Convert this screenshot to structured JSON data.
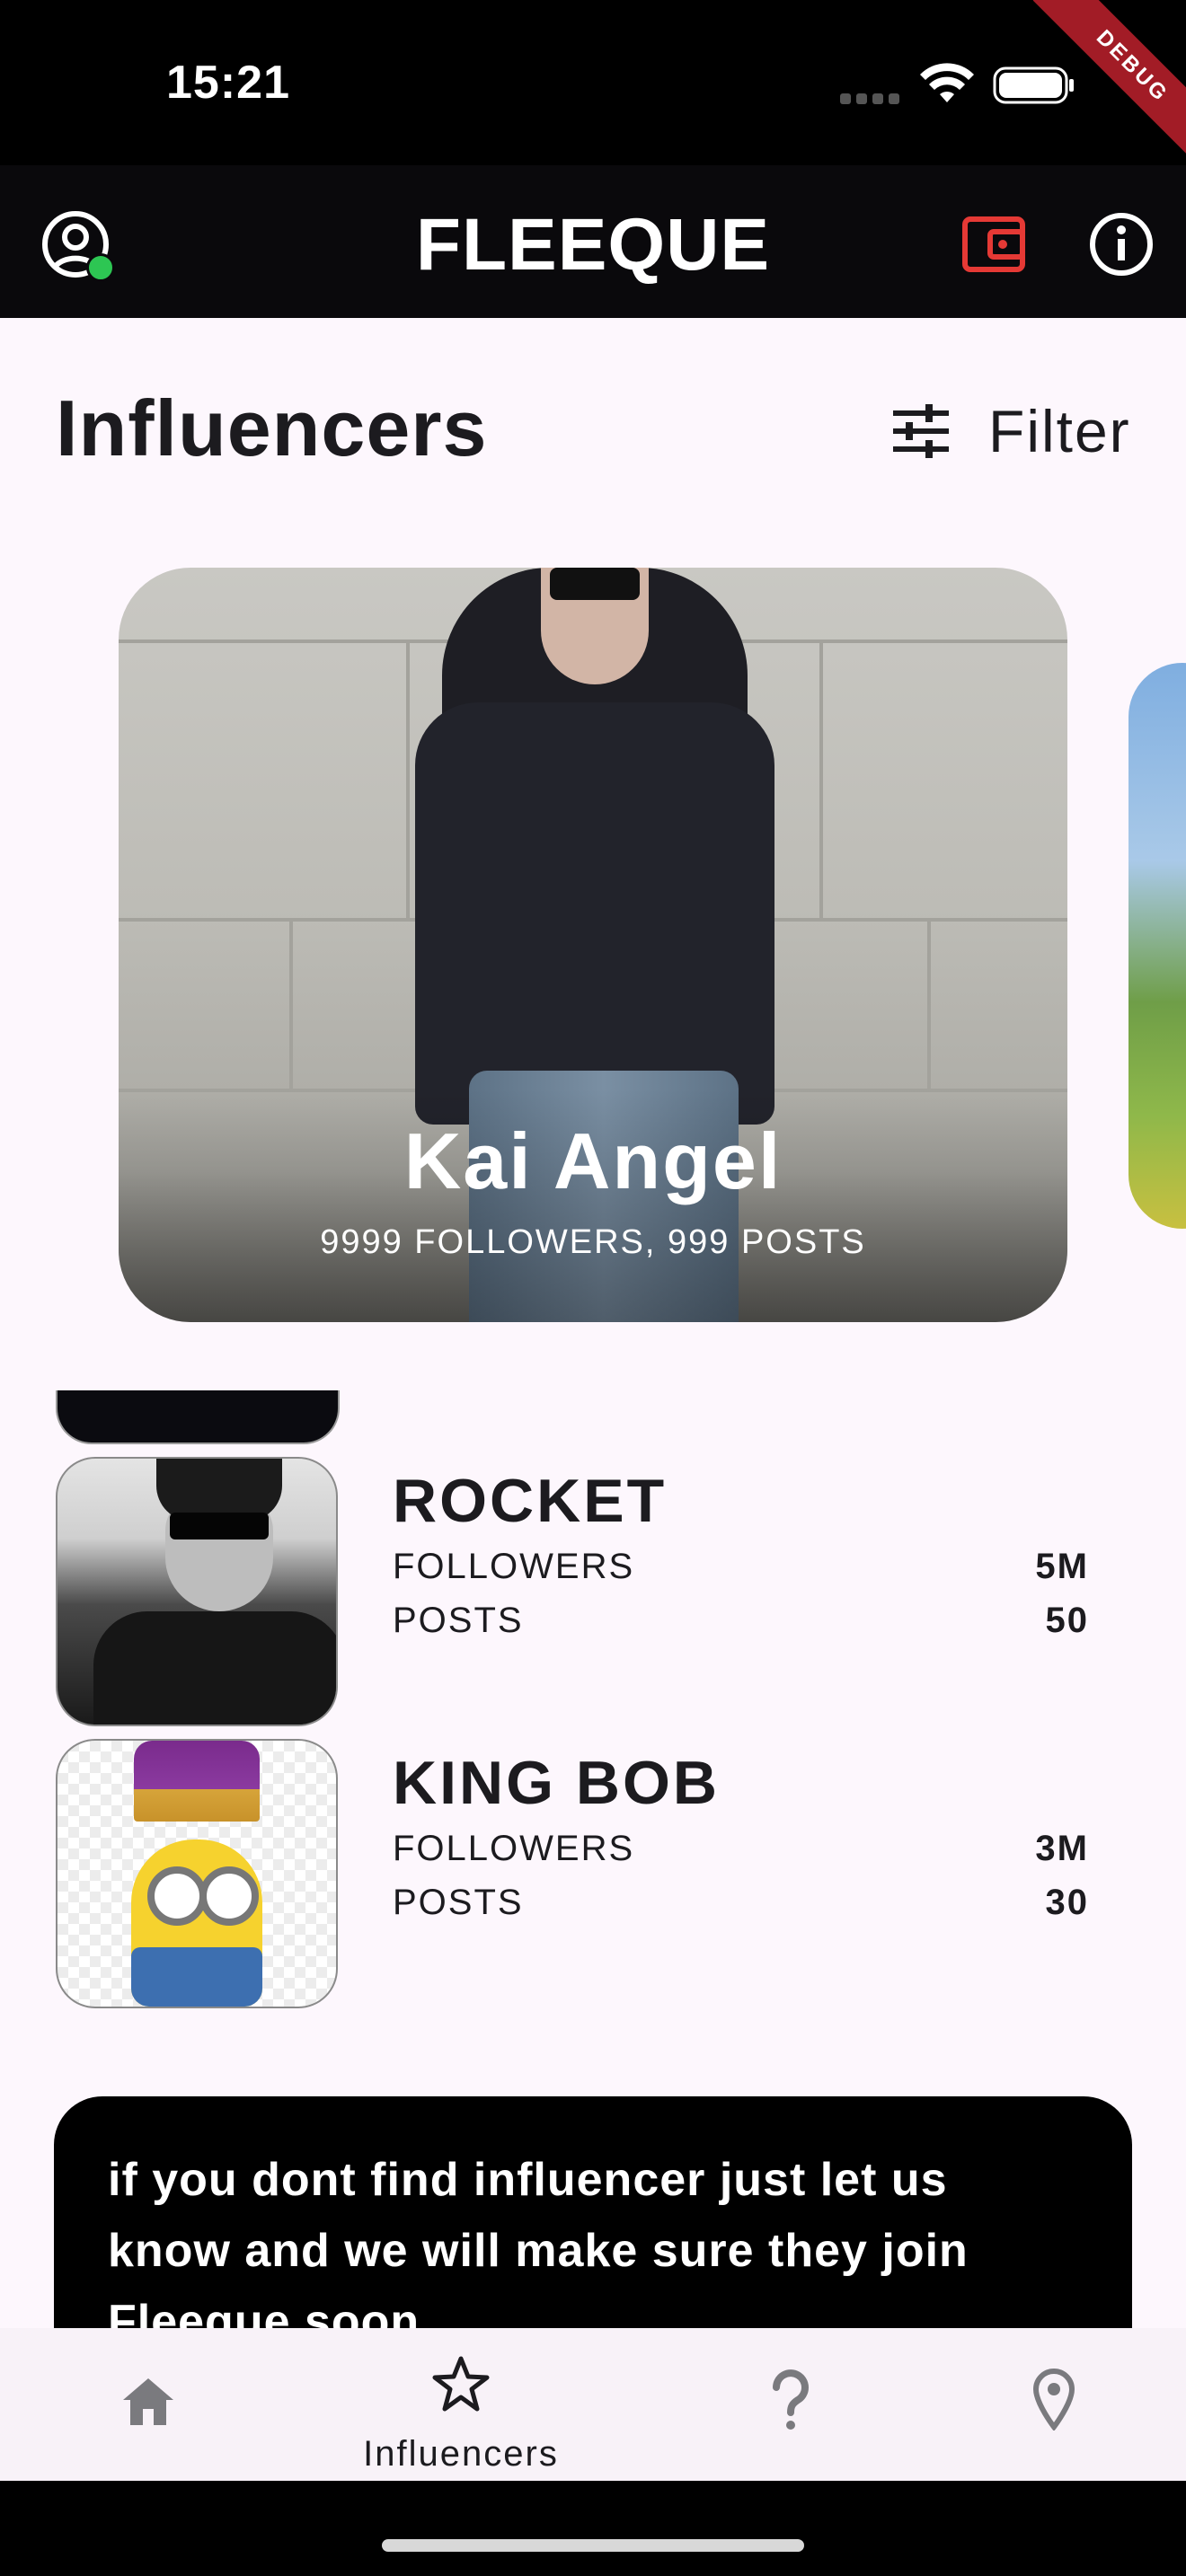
{
  "status_bar": {
    "time": "15:21"
  },
  "debug_label": "DEBUG",
  "app_bar": {
    "title": "FLEEQUE"
  },
  "header": {
    "title": "Influencers",
    "filter_label": "Filter"
  },
  "featured": {
    "name": "Kai Angel",
    "stats": "9999 FOLLOWERS, 999 POSTS"
  },
  "influencers": [
    {
      "name": "ROCKET",
      "followers_label": "FOLLOWERS",
      "followers": "5M",
      "posts_label": "POSTS",
      "posts": "50"
    },
    {
      "name": "KING BOB",
      "followers_label": "FOLLOWERS",
      "followers": "3M",
      "posts_label": "POSTS",
      "posts": "30"
    }
  ],
  "banner": {
    "text": "if you dont find influencer just let us know and we will make sure they join Fleeque soon"
  },
  "bottom_nav": {
    "items": [
      {
        "icon": "home-icon",
        "label": ""
      },
      {
        "icon": "star-icon",
        "label": "Influencers",
        "selected": true
      },
      {
        "icon": "question-icon",
        "label": ""
      },
      {
        "icon": "location-pin-icon",
        "label": ""
      }
    ]
  },
  "colors": {
    "accent_red": "#E53935",
    "online_green": "#2DC653",
    "app_bar": "#0A090C",
    "background": "#FDF7FD"
  }
}
